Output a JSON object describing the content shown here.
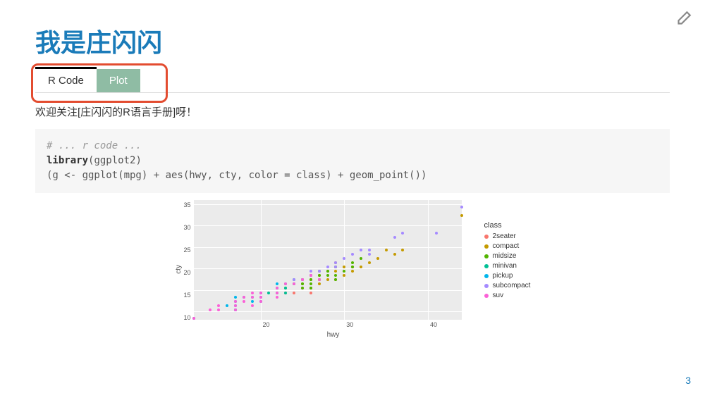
{
  "header": {
    "title": "我是庄闪闪"
  },
  "tabs": {
    "code_label": "R Code",
    "plot_label": "Plot"
  },
  "subtitle": "欢迎关注[庄闪闪的R语言手册]呀！",
  "code": {
    "line1": "# ... r code ...",
    "line2a": "library",
    "line2b": "(ggplot2)",
    "line3": "(g <- ggplot(mpg) + aes(hwy, cty, color = class) + geom_point())"
  },
  "page_number": "3",
  "chart_data": {
    "type": "scatter",
    "title": "",
    "xlabel": "hwy",
    "ylabel": "cty",
    "xlim": [
      12,
      44
    ],
    "ylim": [
      8,
      36
    ],
    "x_ticks": [
      20,
      30,
      40
    ],
    "y_ticks": [
      10,
      15,
      20,
      25,
      30,
      35
    ],
    "legend_title": "class",
    "series": [
      {
        "name": "2seater",
        "color": "#F8766D",
        "points": [
          [
            23,
            15
          ],
          [
            25,
            16
          ],
          [
            26,
            15
          ],
          [
            24,
            15
          ],
          [
            26,
            16
          ]
        ]
      },
      {
        "name": "compact",
        "color": "#C49A00",
        "points": [
          [
            29,
            18
          ],
          [
            29,
            21
          ],
          [
            31,
            20
          ],
          [
            30,
            21
          ],
          [
            26,
            16
          ],
          [
            27,
            18
          ],
          [
            26,
            18
          ],
          [
            25,
            18
          ],
          [
            28,
            18
          ],
          [
            27,
            19
          ],
          [
            25,
            17
          ],
          [
            29,
            20
          ],
          [
            27,
            17
          ],
          [
            30,
            19
          ],
          [
            31,
            21
          ],
          [
            26,
            19
          ],
          [
            28,
            20
          ],
          [
            29,
            22
          ],
          [
            33,
            22
          ],
          [
            32,
            21
          ],
          [
            34,
            23
          ],
          [
            36,
            24
          ],
          [
            35,
            25
          ],
          [
            37,
            25
          ],
          [
            44,
            33
          ]
        ]
      },
      {
        "name": "midsize",
        "color": "#53B400",
        "points": [
          [
            26,
            18
          ],
          [
            27,
            19
          ],
          [
            25,
            17
          ],
          [
            28,
            19
          ],
          [
            29,
            21
          ],
          [
            26,
            16
          ],
          [
            25,
            18
          ],
          [
            27,
            18
          ],
          [
            28,
            20
          ],
          [
            29,
            19
          ],
          [
            31,
            22
          ],
          [
            32,
            23
          ],
          [
            26,
            17
          ],
          [
            25,
            16
          ],
          [
            23,
            16
          ],
          [
            24,
            17
          ],
          [
            27,
            20
          ],
          [
            30,
            20
          ],
          [
            29,
            18
          ],
          [
            31,
            21
          ],
          [
            26,
            19
          ]
        ]
      },
      {
        "name": "minivan",
        "color": "#00C094",
        "points": [
          [
            24,
            18
          ],
          [
            24,
            17
          ],
          [
            22,
            16
          ],
          [
            22,
            15
          ],
          [
            17,
            11
          ],
          [
            23,
            16
          ],
          [
            23,
            15
          ],
          [
            21,
            15
          ],
          [
            23,
            17
          ]
        ]
      },
      {
        "name": "pickup",
        "color": "#00B6EB",
        "points": [
          [
            19,
            14
          ],
          [
            20,
            13
          ],
          [
            17,
            13
          ],
          [
            17,
            11
          ],
          [
            16,
            12
          ],
          [
            12,
            9
          ],
          [
            17,
            14
          ],
          [
            19,
            13
          ],
          [
            18,
            14
          ],
          [
            20,
            15
          ],
          [
            22,
            16
          ],
          [
            20,
            14
          ],
          [
            22,
            17
          ],
          [
            17,
            12
          ]
        ]
      },
      {
        "name": "subcompact",
        "color": "#A58AFF",
        "points": [
          [
            26,
            19
          ],
          [
            25,
            18
          ],
          [
            28,
            21
          ],
          [
            29,
            22
          ],
          [
            27,
            20
          ],
          [
            33,
            24
          ],
          [
            32,
            25
          ],
          [
            36,
            28
          ],
          [
            37,
            29
          ],
          [
            44,
            35
          ],
          [
            41,
            29
          ],
          [
            29,
            21
          ],
          [
            30,
            23
          ],
          [
            31,
            24
          ],
          [
            33,
            25
          ],
          [
            26,
            20
          ],
          [
            24,
            18
          ]
        ]
      },
      {
        "name": "suv",
        "color": "#FB61D7",
        "points": [
          [
            20,
            14
          ],
          [
            15,
            11
          ],
          [
            20,
            13
          ],
          [
            17,
            13
          ],
          [
            19,
            14
          ],
          [
            14,
            11
          ],
          [
            15,
            12
          ],
          [
            17,
            12
          ],
          [
            18,
            14
          ],
          [
            19,
            12
          ],
          [
            22,
            16
          ],
          [
            19,
            15
          ],
          [
            20,
            15
          ],
          [
            22,
            15
          ],
          [
            12,
            9
          ],
          [
            18,
            13
          ],
          [
            17,
            11
          ],
          [
            23,
            17
          ],
          [
            24,
            17
          ],
          [
            25,
            18
          ],
          [
            27,
            18
          ],
          [
            26,
            19
          ],
          [
            22,
            14
          ]
        ]
      }
    ]
  }
}
